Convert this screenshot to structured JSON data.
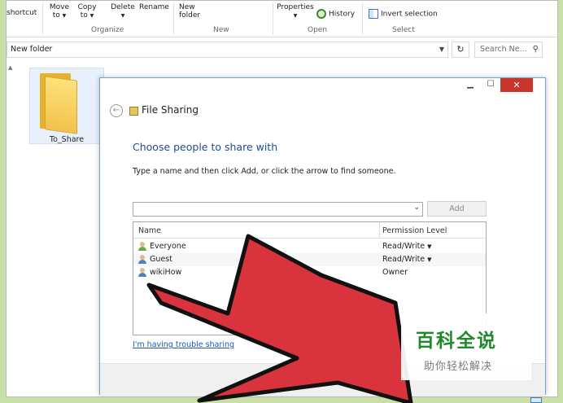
{
  "ribbon": {
    "shortcut": "shortcut",
    "move_to": "Move\nto",
    "copy_to": "Copy\nto",
    "delete": "Delete",
    "rename": "Rename",
    "new_folder": "New\nfolder",
    "properties": "Properties",
    "history": "History",
    "invert_selection": "Invert selection",
    "groups": {
      "organize": "Organize",
      "new": "New",
      "open": "Open",
      "select": "Select"
    }
  },
  "address": {
    "path": "New folder",
    "search_placeholder": "Search Ne..."
  },
  "folder": {
    "label": "To_Share"
  },
  "dialog": {
    "title": "File Sharing",
    "heading": "Choose people to share with",
    "instruction": "Type a name and then click Add, or click the arrow to find someone.",
    "add_label": "Add",
    "columns": {
      "name": "Name",
      "permission": "Permission Level"
    },
    "rows": [
      {
        "name": "Everyone",
        "permission": "Read/Write",
        "has_dropdown": true
      },
      {
        "name": "Guest",
        "permission": "Read/Write",
        "has_dropdown": true
      },
      {
        "name": "wikiHow",
        "permission": "Owner",
        "has_dropdown": false
      }
    ],
    "trouble_link": "I'm having trouble sharing"
  },
  "watermark": {
    "main": "百科全说",
    "sub": "助你轻松解决"
  },
  "colors": {
    "background": "#c9dfa8",
    "heading_blue": "#1f4e8c",
    "link_blue": "#1a58b8",
    "close_red": "#c9342d",
    "arrow_red": "#d6343f",
    "watermark_green": "#1e8a2c"
  }
}
